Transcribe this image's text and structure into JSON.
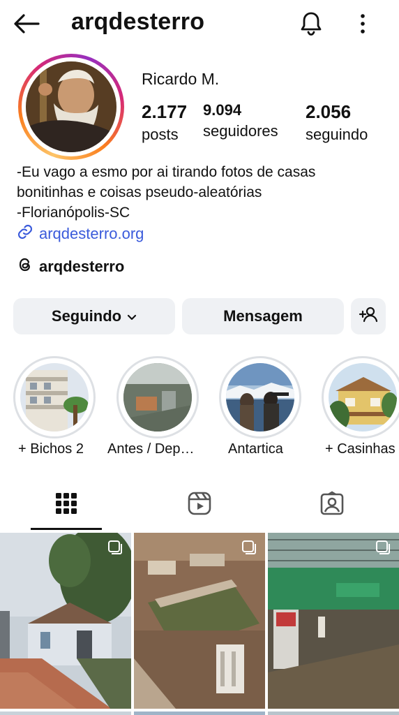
{
  "header": {
    "username": "arqdesterro"
  },
  "profile": {
    "display_name": "Ricardo M.",
    "stats": [
      {
        "value": "2.177",
        "label": "posts"
      },
      {
        "value": "9.094",
        "label": "seguidores"
      },
      {
        "value": "2.056",
        "label": "seguindo"
      }
    ],
    "bio_lines": [
      "-Eu vago a esmo por ai tirando fotos de casas",
      "bonitinhas e coisas pseudo-aleatórias",
      "-Florianópolis-SC"
    ],
    "link": "arqdesterro.org",
    "threads_handle": "arqdesterro"
  },
  "actions": {
    "follow_label": "Seguindo",
    "message_label": "Mensagem"
  },
  "highlights": [
    {
      "label": "+ Bichos 2"
    },
    {
      "label": "Antes / Dep…"
    },
    {
      "label": "Antartica"
    },
    {
      "label": "+ Casinhas"
    }
  ],
  "tabs": [
    "grid-icon",
    "reels-icon",
    "tagged-icon"
  ],
  "colors": {
    "link": "#3b5bdb",
    "button_bg": "#eff1f4"
  }
}
